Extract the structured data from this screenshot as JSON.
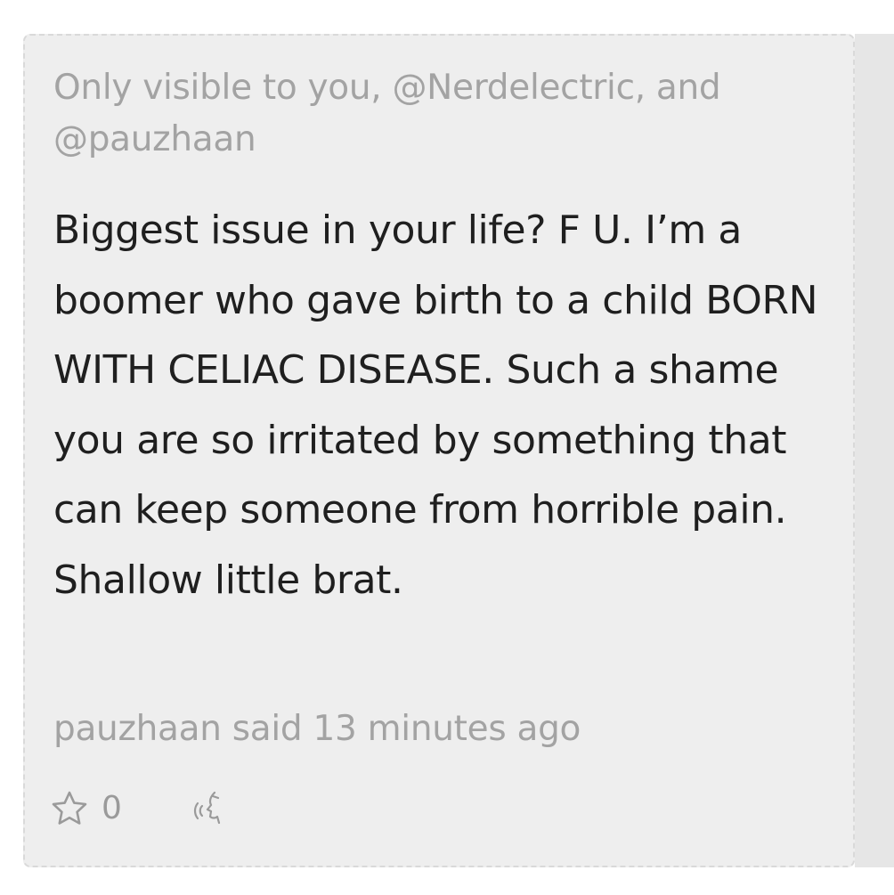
{
  "comment": {
    "visibility_note": "Only visible to you, @Nerdelectric, and @pauzhaan",
    "body": "Biggest issue in your life? F U. I’m a boomer who gave birth to a child BORN WITH CELIAC DISEASE. Such a shame you are so irritated by something that can keep someone from horrible pain. Shallow little brat.",
    "meta": "pauzhaan said 13 minutes ago",
    "star_count": "0",
    "icons": {
      "star": "star-outline-icon",
      "speak": "speak-aloud-icon"
    },
    "colors": {
      "card_background": "#eeeeee",
      "muted_text": "#a3a3a3",
      "body_text": "#1f1f1f"
    }
  }
}
